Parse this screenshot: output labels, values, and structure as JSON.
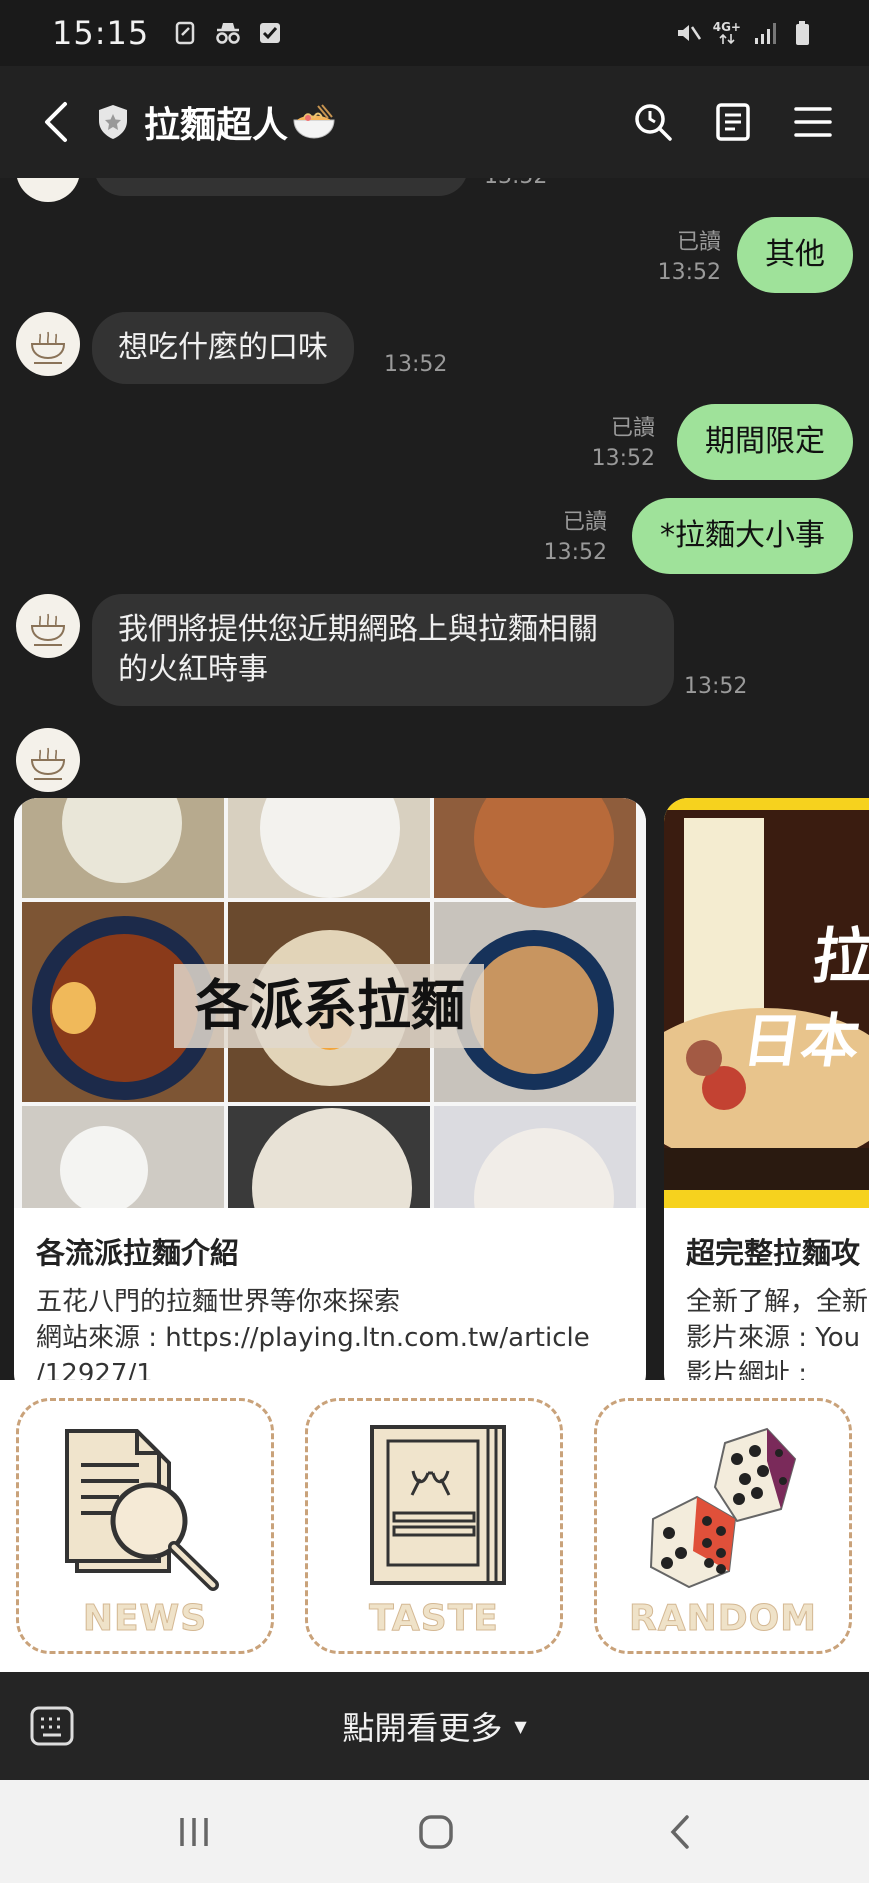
{
  "status_bar": {
    "time": "15:15",
    "network": "4G+"
  },
  "header": {
    "title": "拉麵超人"
  },
  "messages": {
    "out_other": {
      "text": "其他",
      "read": "已讀",
      "time": "13:52"
    },
    "in_flavor": {
      "text": "想吃什麼的口味",
      "time": "13:52"
    },
    "out_limited": {
      "text": "期間限定",
      "read": "已讀",
      "time": "13:52"
    },
    "out_news": {
      "text": "*拉麵大小事",
      "read": "已讀",
      "time": "13:52"
    },
    "in_provide": {
      "line1": "我們將提供您近期網路上與拉麵相關",
      "line2": "的火紅時事",
      "time": "13:52"
    },
    "partial_time": "13:52"
  },
  "cards": [
    {
      "image_text": "各派系拉麵",
      "title": "各流派拉麵介紹",
      "desc1": "五花八門的拉麵世界等你來探索",
      "desc2": "網站來源 : https://playing.ltn.com.tw/article",
      "desc3": "/12927/1"
    },
    {
      "image_text_1": "拉",
      "image_text_2": "日本",
      "title": "超完整拉麵攻",
      "desc1": "全新了解，全新",
      "desc2": "影片來源 : You",
      "desc3": "影片網址 : "
    }
  ],
  "rich_menu": {
    "news": "NEWS",
    "taste": "TASTE",
    "random": "RANDOM"
  },
  "bottom_bar": {
    "more_label": "點開看更多",
    "caret": "▼"
  },
  "colors": {
    "outgoing_bubble": "#9fe29a",
    "incoming_bubble": "#333333",
    "background": "#1e1e1e",
    "menu_border": "#c9a27a"
  }
}
